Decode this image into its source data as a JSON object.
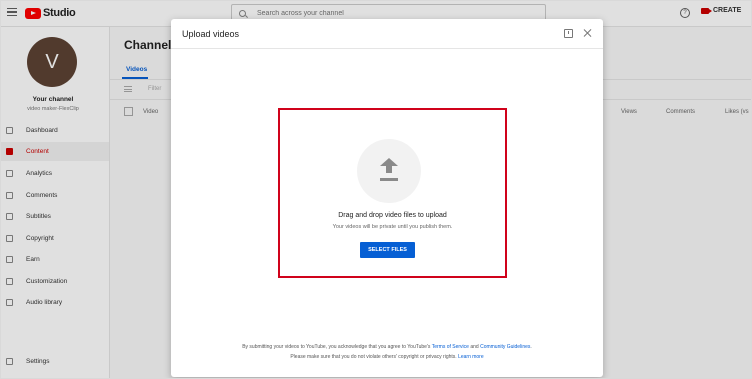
{
  "topbar": {
    "logo_text": "Studio",
    "search_placeholder": "Search across your channel",
    "help_label": "?",
    "create_label": "CREATE"
  },
  "sidebar": {
    "avatar_letter": "V",
    "channel_title": "Your channel",
    "channel_subtitle": "video maker-FlexClip",
    "items": [
      {
        "label": "Dashboard",
        "icon": "dashboard-icon"
      },
      {
        "label": "Content",
        "icon": "content-icon",
        "active": true
      },
      {
        "label": "Analytics",
        "icon": "analytics-icon"
      },
      {
        "label": "Comments",
        "icon": "comments-icon"
      },
      {
        "label": "Subtitles",
        "icon": "subtitles-icon"
      },
      {
        "label": "Copyright",
        "icon": "copyright-icon"
      },
      {
        "label": "Earn",
        "icon": "earn-icon"
      },
      {
        "label": "Customization",
        "icon": "customization-icon"
      },
      {
        "label": "Audio library",
        "icon": "audio-library-icon"
      }
    ],
    "settings_label": "Settings"
  },
  "main": {
    "title_partial": "Channel c",
    "tab_videos": "Videos",
    "filter_text": "Filter",
    "columns": [
      "Video",
      "Views",
      "Comments",
      "Likes (vs"
    ]
  },
  "modal": {
    "title": "Upload videos",
    "drag_text": "Drag and drop video files to upload",
    "private_text": "Your videos will be private until you publish them.",
    "select_button": "SELECT FILES",
    "footer_part1": "By submitting your videos to YouTube, you acknowledge that you agree to YouTube's ",
    "terms_link": "Terms of Service",
    "footer_and": " and ",
    "guidelines_link": "Community Guidelines",
    "footer_end": ".",
    "footer_part2": "Please make sure that you do not violate others' copyright or privacy rights. ",
    "learn_more_link": "Learn more"
  },
  "colors": {
    "accent": "#065fd4",
    "brand_red": "#ff0000",
    "highlight_border": "#d0021b"
  }
}
